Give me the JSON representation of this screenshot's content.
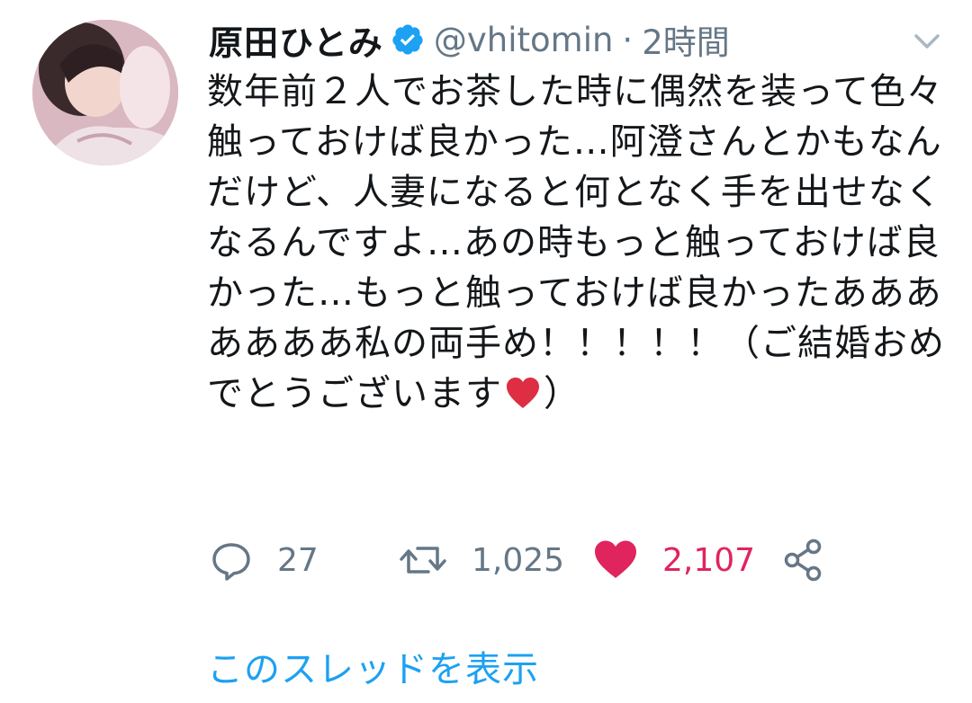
{
  "author": {
    "display_name": "原田ひとみ",
    "handle": "@vhitomin",
    "separator": "·",
    "timestamp": "2時間",
    "verified_icon": "verified-badge-icon",
    "verified_color": "#1da1f2"
  },
  "tweet": {
    "text_main": "数年前２人でお茶した時に偶然を装って色々触っておけば良かった…阿澄さんとかもなんだけど、人妻になると何となく手を出せなくなるんですよ…あの時もっと触っておけば良かった…もっと触っておけば良かったあああああああ私の両手め！！！！！（ご結婚おめでとうございます",
    "emoji": "red-heart-icon",
    "text_end": "）"
  },
  "actions": {
    "reply": {
      "icon": "reply-icon",
      "count": "27"
    },
    "retweet": {
      "icon": "retweet-icon",
      "count": "1,025"
    },
    "like": {
      "icon": "heart-icon",
      "count": "2,107",
      "liked": true,
      "color": "#e0245e"
    },
    "share": {
      "icon": "share-icon"
    }
  },
  "menu": {
    "icon": "chevron-down-icon"
  },
  "show_thread_label": "このスレッドを表示",
  "colors": {
    "text": "#14171a",
    "secondary": "#657786",
    "link": "#1da1f2",
    "like": "#e0245e"
  }
}
